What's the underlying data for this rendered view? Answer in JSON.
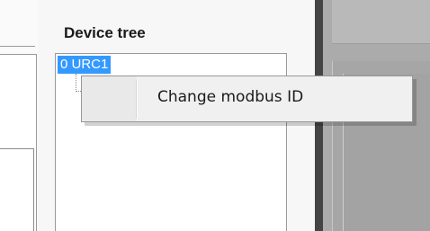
{
  "device_tree": {
    "heading": "Device tree",
    "nodes": [
      {
        "label": "0 URC1",
        "selected": true
      }
    ]
  },
  "context_menu": {
    "items": [
      {
        "label": "Change modbus ID"
      }
    ]
  },
  "colors": {
    "selection": "#3399ff",
    "dimmed_region": "#ababab"
  }
}
